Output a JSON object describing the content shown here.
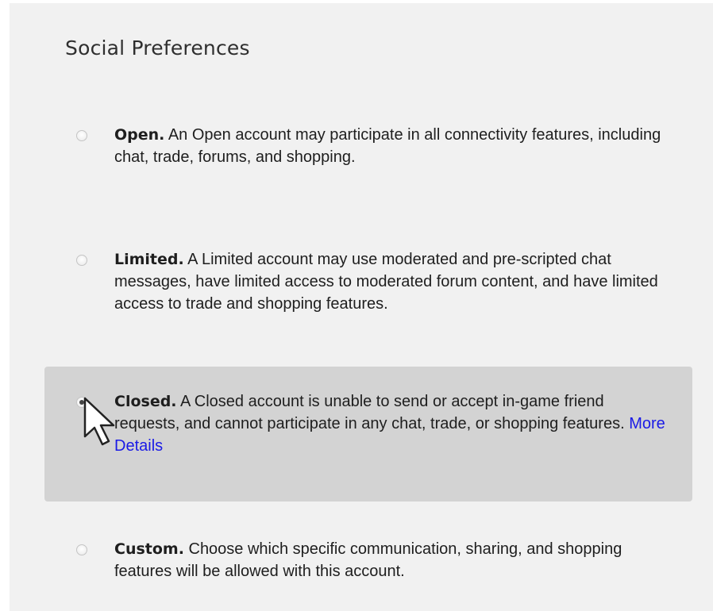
{
  "page": {
    "title": "Social Preferences"
  },
  "options": [
    {
      "lead": "Open.",
      "description": " An Open account may participate in all connectivity features, including chat, trade, forums, and shopping.",
      "selected": false
    },
    {
      "lead": "Limited.",
      "description": " A Limited account may use moderated and pre-scripted chat messages, have limited access to moderated forum content, and have limited access to trade and shopping features.",
      "selected": false
    },
    {
      "lead": "Closed.",
      "description": " A Closed account is unable to send or accept in-game friend requests, and cannot participate in any chat, trade, or shopping features. ",
      "link": "More Details",
      "selected": true
    },
    {
      "lead": "Custom.",
      "description": " Choose which specific communication, sharing, and shopping features will be allowed with this account.",
      "selected": false
    }
  ],
  "colors": {
    "panel_bg": "#f1f1f1",
    "selected_bg": "#d3d3d3",
    "link": "#1a1ae6"
  },
  "icons": {
    "cursor": "mouse-pointer-icon",
    "radio": "radio-button"
  }
}
